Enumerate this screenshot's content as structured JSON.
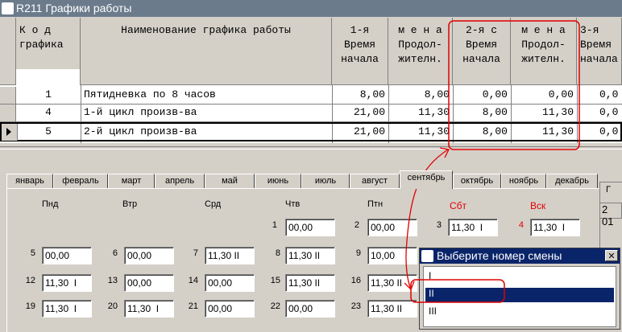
{
  "window": {
    "title": "R211 Графики работы"
  },
  "grid": {
    "headers": [
      {
        "lines": [
          "К о д",
          "графика"
        ]
      },
      {
        "lines": [
          "Наименование графика работы"
        ]
      },
      {
        "lines": [
          "1-я",
          "Время",
          "начала"
        ]
      },
      {
        "lines": [
          "м е н а",
          "Продол-",
          "жителн."
        ]
      },
      {
        "lines": [
          "2-я с",
          "Время",
          "начала"
        ]
      },
      {
        "lines": [
          "м е н а",
          "Продол-",
          "жителн."
        ]
      },
      {
        "lines": [
          "3-я",
          "Время",
          "начала"
        ]
      }
    ],
    "rows": [
      {
        "code": "1",
        "name": "Пятидневка по 8 часов",
        "s1_start": "8,00",
        "s1_dur": "8,00",
        "s2_start": "0,00",
        "s2_dur": "0,00",
        "s3_start": "0,0"
      },
      {
        "code": "4",
        "name": "1-й цикл произв-ва",
        "s1_start": "21,00",
        "s1_dur": "11,30",
        "s2_start": "8,00",
        "s2_dur": "11,30",
        "s3_start": "0,0"
      },
      {
        "code": "5",
        "name": "2-й цикл произв-ва",
        "s1_start": "21,00",
        "s1_dur": "11,30",
        "s2_start": "8,00",
        "s2_dur": "11,30",
        "s3_start": "0,0"
      }
    ]
  },
  "months": [
    "январь",
    "февраль",
    "март",
    "апрель",
    "май",
    "июнь",
    "июль",
    "август",
    "сентябрь",
    "октябрь",
    "ноябрь",
    "декабрь"
  ],
  "active_month": "сентябрь",
  "weekdays": [
    "Пнд",
    "Втр",
    "Срд",
    "Чтв",
    "Птн",
    "Сбт",
    "Вск"
  ],
  "weekend_color": "#e00000",
  "right_box": {
    "label": "Г",
    "value": "2 01"
  },
  "calendar": [
    {
      "day": "1",
      "value": "00,00"
    },
    {
      "day": "2",
      "value": "00,00"
    },
    {
      "day": "3",
      "value": "11,30  I"
    },
    {
      "day": "4",
      "value": "11,30  I"
    },
    {
      "day": "5",
      "value": "00,00"
    },
    {
      "day": "6",
      "value": "00,00"
    },
    {
      "day": "7",
      "value": "11,30 II"
    },
    {
      "day": "8",
      "value": "11,30 II"
    },
    {
      "day": "9",
      "value": "10,00"
    },
    {
      "day": "12",
      "value": "11,30  I"
    },
    {
      "day": "13",
      "value": "00,00"
    },
    {
      "day": "14",
      "value": "00,00"
    },
    {
      "day": "15",
      "value": "11,30 II"
    },
    {
      "day": "16",
      "value": "11,30 II"
    },
    {
      "day": "19",
      "value": "11,30  I"
    },
    {
      "day": "20",
      "value": "11,30  I"
    },
    {
      "day": "21",
      "value": "00,00"
    },
    {
      "day": "22",
      "value": "00,00"
    },
    {
      "day": "23",
      "value": "11,30 II"
    }
  ],
  "popup": {
    "title": "Выберите номер смены",
    "close_label": "✕",
    "items": [
      "I",
      "II",
      "III"
    ],
    "selected": "II"
  },
  "annotation_color": "#e00000"
}
